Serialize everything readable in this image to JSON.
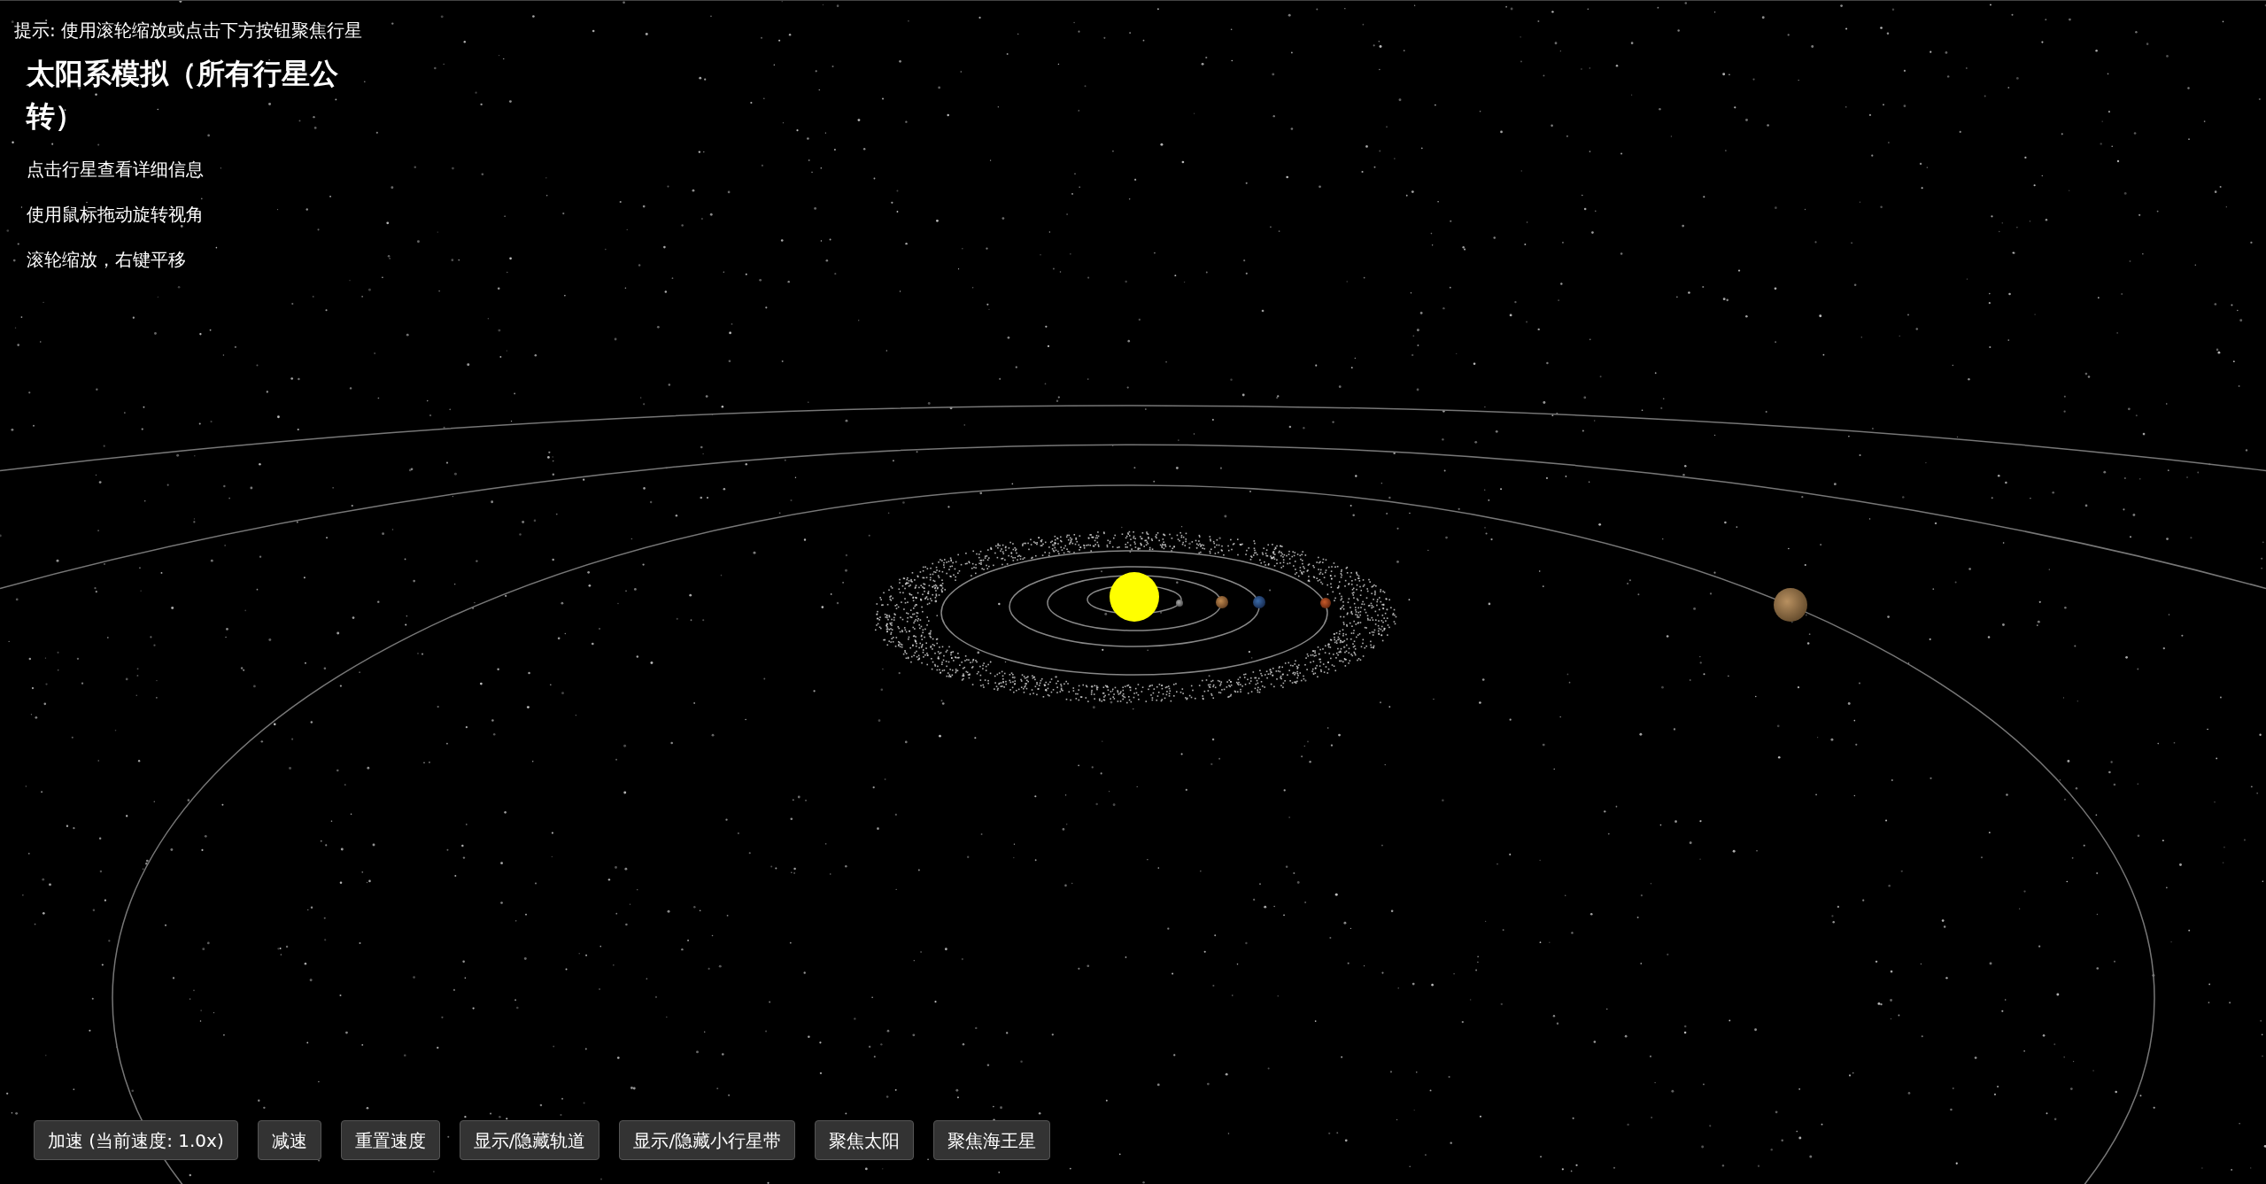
{
  "hint": "提示: 使用滚轮缩放或点击下方按钮聚焦行星",
  "info": {
    "title": "太阳系模拟（所有行星公转）",
    "lines": [
      "点击行星查看详细信息",
      "使用鼠标拖动旋转视角",
      "滚轮缩放，右键平移"
    ]
  },
  "buttons": [
    "加速 (当前速度: 1.0x)",
    "减速",
    "重置速度",
    "显示/隐藏轨道",
    "显示/隐藏小行星带",
    "聚焦太阳",
    "聚焦海王星"
  ]
}
